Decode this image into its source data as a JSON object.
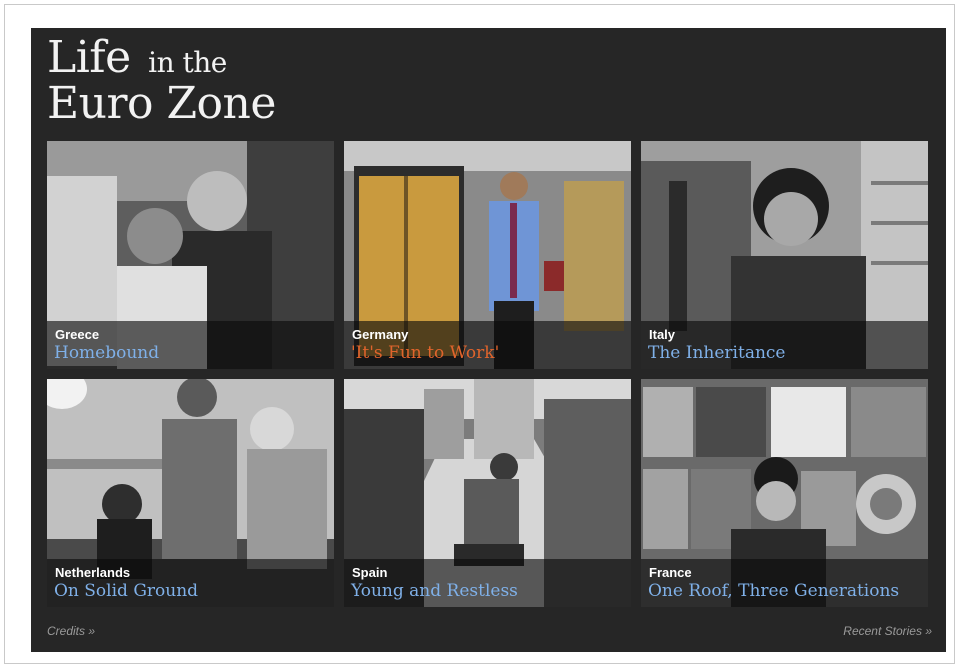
{
  "header": {
    "title_line1_big": "Life",
    "title_line1_small": "in the",
    "title_line2": "Euro Zone"
  },
  "stories": [
    {
      "country": "Greece",
      "title": "Homebound"
    },
    {
      "country": "Germany",
      "title": "'It's Fun to Work'"
    },
    {
      "country": "Italy",
      "title": "The Inheritance"
    },
    {
      "country": "Netherlands",
      "title": "On Solid Ground"
    },
    {
      "country": "Spain",
      "title": "Young and Restless"
    },
    {
      "country": "France",
      "title": "One Roof, Three Generations"
    }
  ],
  "footer": {
    "credits": "Credits »",
    "recent": "Recent Stories »"
  },
  "colors": {
    "panel": "#262626",
    "link_blue": "#7fb0e8",
    "highlight_orange": "#e0642c"
  }
}
